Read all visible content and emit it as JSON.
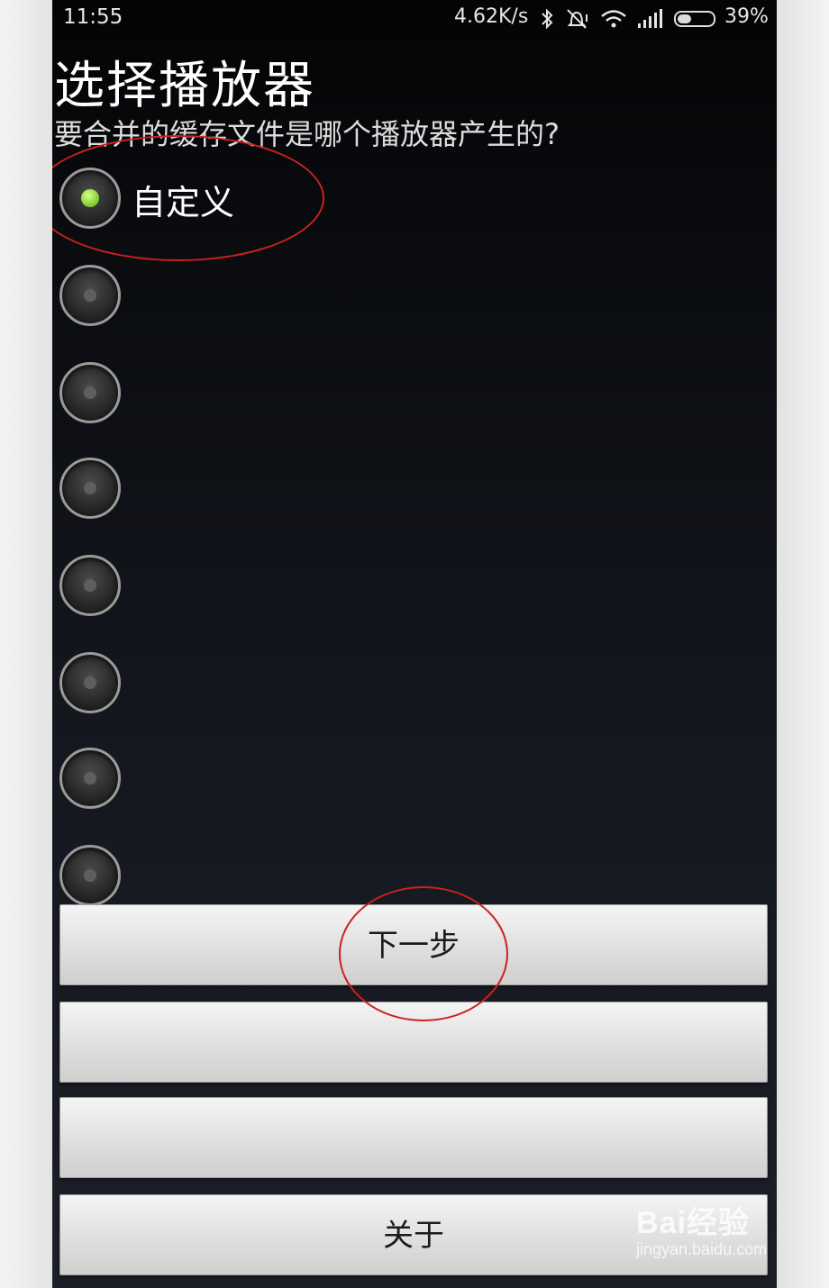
{
  "status_bar": {
    "time": "11:55",
    "net_speed": "4.62K/s",
    "battery_percent": "39%",
    "icons": [
      "bluetooth-icon",
      "vibrate-off-icon",
      "wifi-icon",
      "signal-icon",
      "battery-icon"
    ]
  },
  "dialog": {
    "title": "选择播放器",
    "subtitle": "要合并的缓存文件是哪个播放器产生的?",
    "options": [
      {
        "label": "自定义",
        "selected": true
      },
      {
        "label": "",
        "selected": false
      },
      {
        "label": "",
        "selected": false
      },
      {
        "label": "",
        "selected": false
      },
      {
        "label": "",
        "selected": false
      },
      {
        "label": "",
        "selected": false
      },
      {
        "label": "",
        "selected": false
      },
      {
        "label": "",
        "selected": false
      }
    ]
  },
  "buttons": {
    "next_label": "下一步",
    "button2_label": "",
    "button3_label": "",
    "about_label": "关于"
  },
  "watermark": {
    "brand": "Bai经验",
    "url": "jingyan.baidu.com"
  },
  "colors": {
    "background_top": "#030405",
    "background_bottom": "#1c1f27",
    "radio_selected": "#8ad13a",
    "annotation": "#cc2020",
    "button_face": "#e3e3e3"
  }
}
